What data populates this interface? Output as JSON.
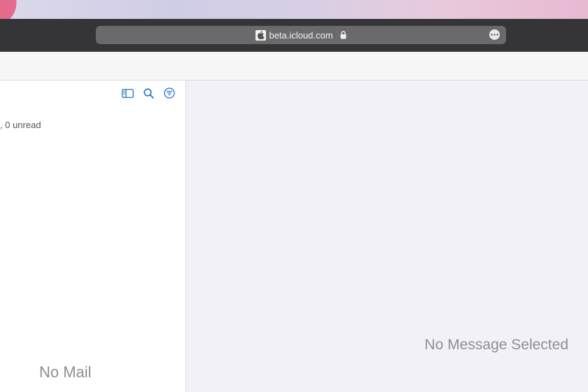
{
  "browser": {
    "url": "beta.icloud.com",
    "favicon_icon": "apple-logo-icon",
    "lock_icon": "lock-icon",
    "more_icon": "ellipsis-circle-icon"
  },
  "mail_list": {
    "toolbar_icons": [
      "sidebar-toggle-icon",
      "search-icon",
      "filter-icon"
    ],
    "unread_text": ", 0 unread",
    "empty_text": "No Mail"
  },
  "message_view": {
    "empty_text": "No Message Selected"
  },
  "colors": {
    "accent": "#1a73c8",
    "toolbar": "#353537",
    "placeholder_text": "#8e8e93"
  }
}
